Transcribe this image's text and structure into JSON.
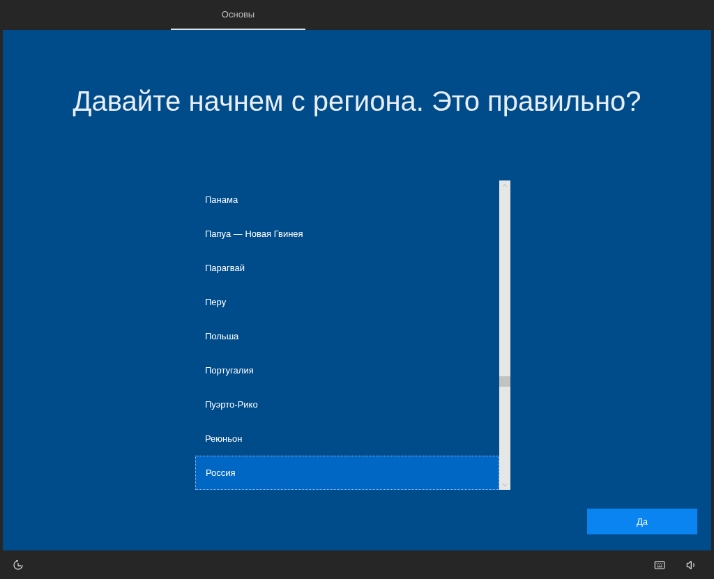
{
  "tabs": [
    {
      "label": "Основы",
      "selected": true
    }
  ],
  "title": "Давайте начнем с региона. Это правильно?",
  "regions": [
    {
      "label": "Панама",
      "selected": false
    },
    {
      "label": "Папуа — Новая Гвинея",
      "selected": false
    },
    {
      "label": "Парагвай",
      "selected": false
    },
    {
      "label": "Перу",
      "selected": false
    },
    {
      "label": "Польша",
      "selected": false
    },
    {
      "label": "Португалия",
      "selected": false
    },
    {
      "label": "Пуэрто-Рико",
      "selected": false
    },
    {
      "label": "Реюньон",
      "selected": false
    },
    {
      "label": "Россия",
      "selected": true
    }
  ],
  "confirm_button": "Да"
}
